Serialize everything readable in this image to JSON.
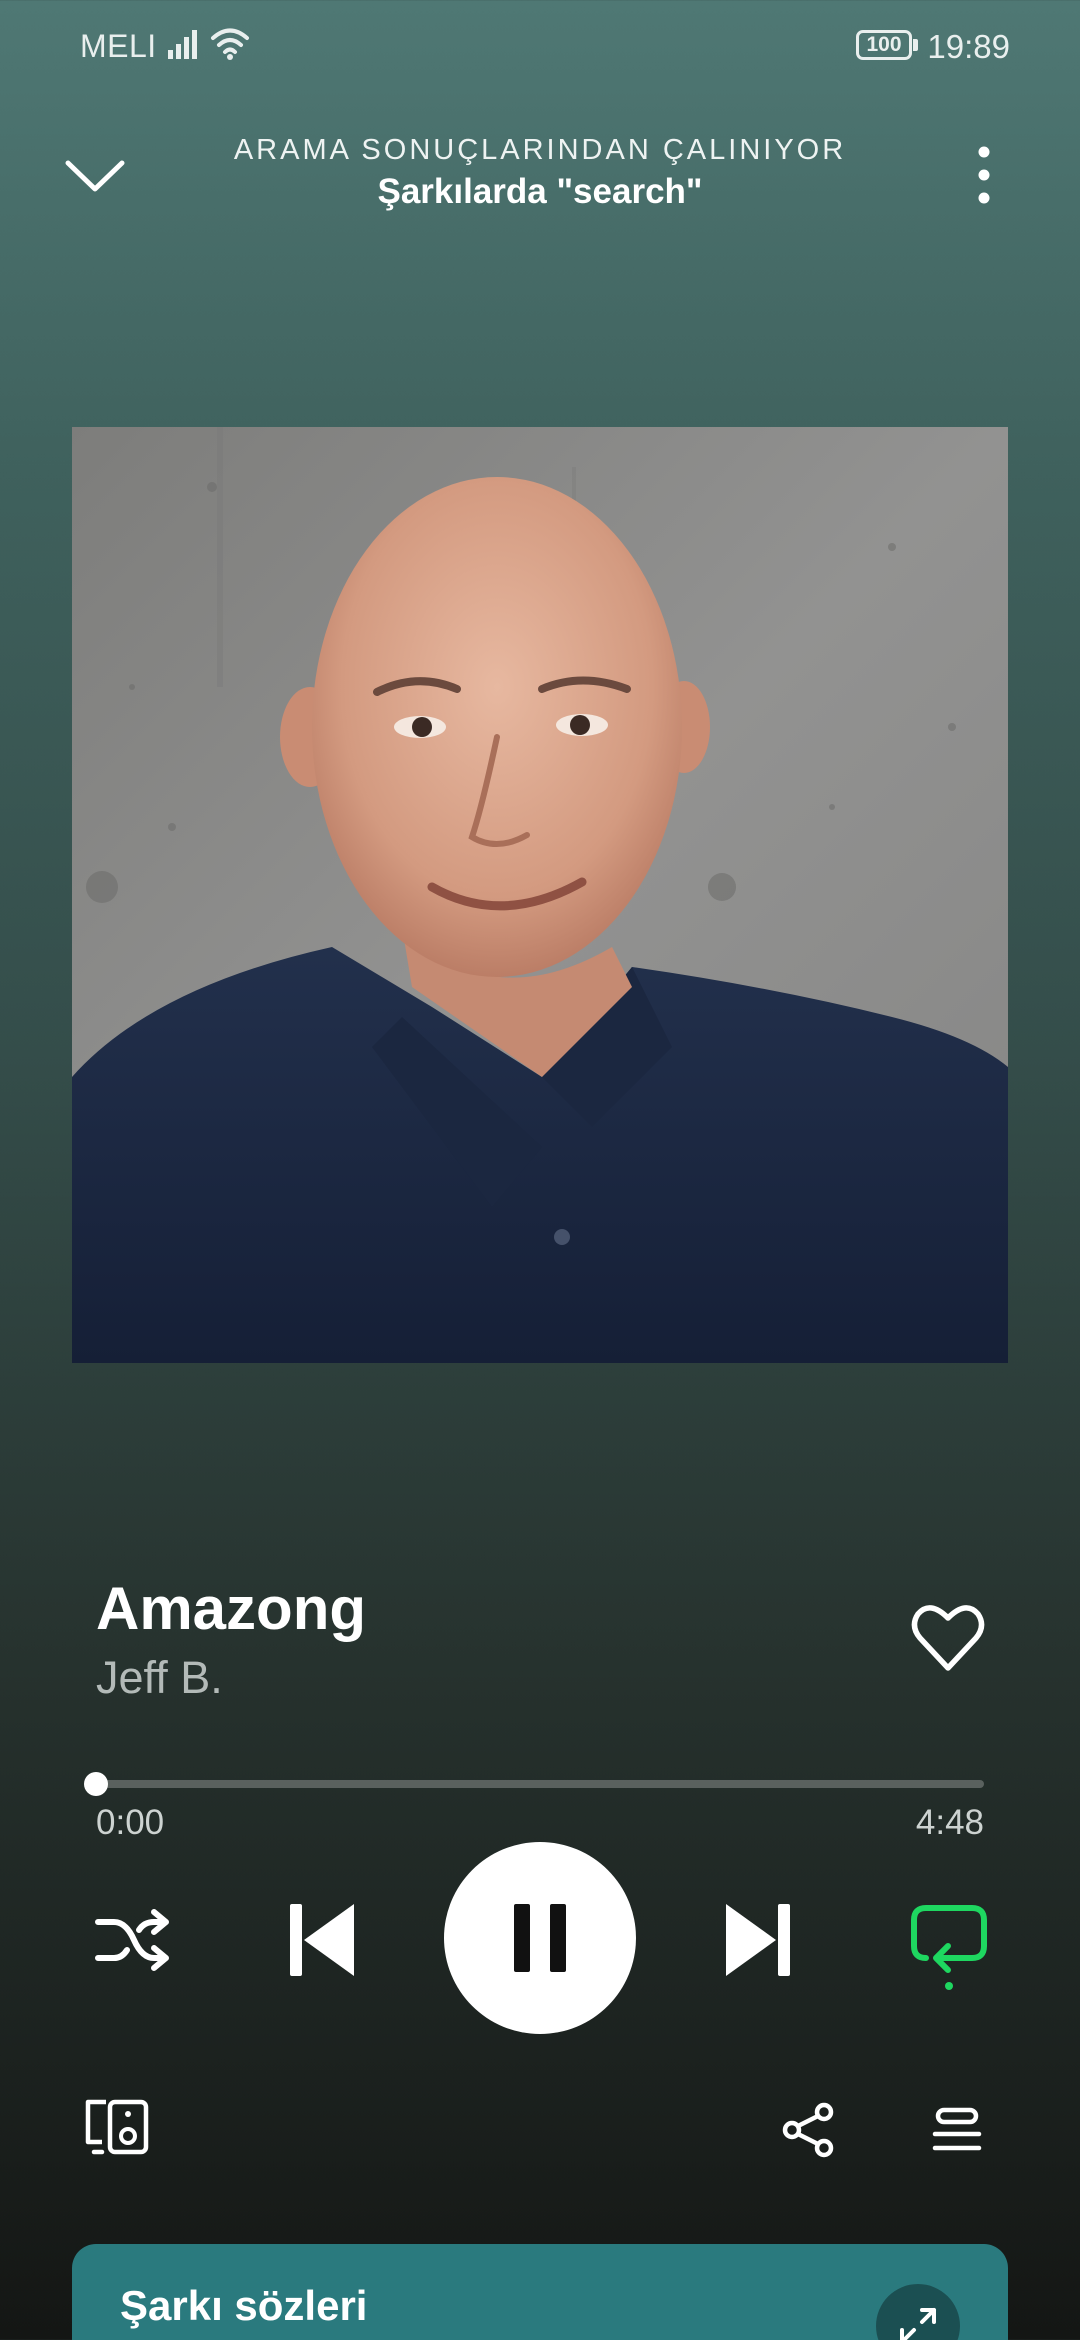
{
  "status_bar": {
    "carrier": "MELI",
    "battery": "100",
    "time": "19:89"
  },
  "header": {
    "context_type": "ARAMA SONUÇLARINDAN ÇALINIYOR",
    "context_name": "Şarkılarda \"search\""
  },
  "artwork": {
    "description_icon": "album-artwork"
  },
  "track": {
    "title": "Amazong",
    "artist": "Jeff B.",
    "liked": false
  },
  "progress": {
    "elapsed": "0:00",
    "total": "4:48",
    "fraction": 0.0
  },
  "controls": {
    "shuffle_icon": "shuffle-icon",
    "previous_icon": "skip-previous-icon",
    "play_state": "playing",
    "next_icon": "skip-next-icon",
    "repeat_icon": "repeat-icon",
    "repeat_active": true
  },
  "secondary": {
    "devices_icon": "connect-device-icon",
    "share_icon": "share-icon",
    "queue_icon": "queue-icon"
  },
  "lyrics": {
    "title": "Şarkı sözleri"
  },
  "colors": {
    "accent_green": "#1ed760",
    "lyrics_card": "#2a7a7e"
  }
}
